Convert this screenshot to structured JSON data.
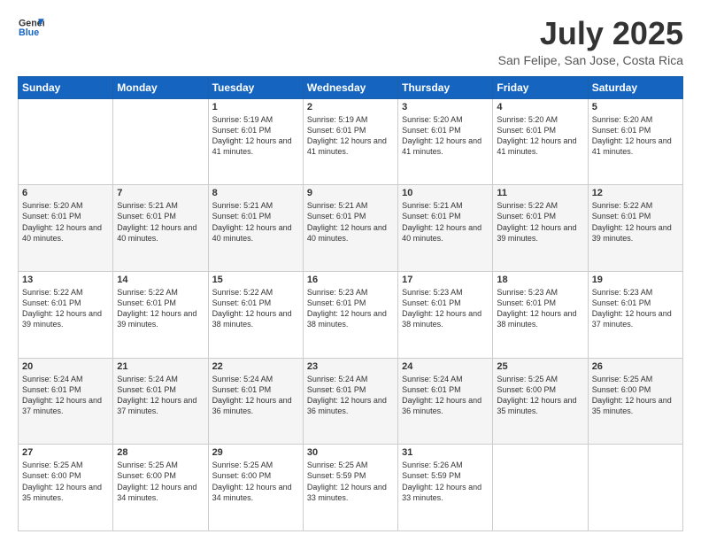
{
  "header": {
    "logo_line1": "General",
    "logo_line2": "Blue",
    "month": "July 2025",
    "location": "San Felipe, San Jose, Costa Rica"
  },
  "weekdays": [
    "Sunday",
    "Monday",
    "Tuesday",
    "Wednesday",
    "Thursday",
    "Friday",
    "Saturday"
  ],
  "weeks": [
    [
      {
        "day": "",
        "text": ""
      },
      {
        "day": "",
        "text": ""
      },
      {
        "day": "1",
        "text": "Sunrise: 5:19 AM\nSunset: 6:01 PM\nDaylight: 12 hours and 41 minutes."
      },
      {
        "day": "2",
        "text": "Sunrise: 5:19 AM\nSunset: 6:01 PM\nDaylight: 12 hours and 41 minutes."
      },
      {
        "day": "3",
        "text": "Sunrise: 5:20 AM\nSunset: 6:01 PM\nDaylight: 12 hours and 41 minutes."
      },
      {
        "day": "4",
        "text": "Sunrise: 5:20 AM\nSunset: 6:01 PM\nDaylight: 12 hours and 41 minutes."
      },
      {
        "day": "5",
        "text": "Sunrise: 5:20 AM\nSunset: 6:01 PM\nDaylight: 12 hours and 41 minutes."
      }
    ],
    [
      {
        "day": "6",
        "text": "Sunrise: 5:20 AM\nSunset: 6:01 PM\nDaylight: 12 hours and 40 minutes."
      },
      {
        "day": "7",
        "text": "Sunrise: 5:21 AM\nSunset: 6:01 PM\nDaylight: 12 hours and 40 minutes."
      },
      {
        "day": "8",
        "text": "Sunrise: 5:21 AM\nSunset: 6:01 PM\nDaylight: 12 hours and 40 minutes."
      },
      {
        "day": "9",
        "text": "Sunrise: 5:21 AM\nSunset: 6:01 PM\nDaylight: 12 hours and 40 minutes."
      },
      {
        "day": "10",
        "text": "Sunrise: 5:21 AM\nSunset: 6:01 PM\nDaylight: 12 hours and 40 minutes."
      },
      {
        "day": "11",
        "text": "Sunrise: 5:22 AM\nSunset: 6:01 PM\nDaylight: 12 hours and 39 minutes."
      },
      {
        "day": "12",
        "text": "Sunrise: 5:22 AM\nSunset: 6:01 PM\nDaylight: 12 hours and 39 minutes."
      }
    ],
    [
      {
        "day": "13",
        "text": "Sunrise: 5:22 AM\nSunset: 6:01 PM\nDaylight: 12 hours and 39 minutes."
      },
      {
        "day": "14",
        "text": "Sunrise: 5:22 AM\nSunset: 6:01 PM\nDaylight: 12 hours and 39 minutes."
      },
      {
        "day": "15",
        "text": "Sunrise: 5:22 AM\nSunset: 6:01 PM\nDaylight: 12 hours and 38 minutes."
      },
      {
        "day": "16",
        "text": "Sunrise: 5:23 AM\nSunset: 6:01 PM\nDaylight: 12 hours and 38 minutes."
      },
      {
        "day": "17",
        "text": "Sunrise: 5:23 AM\nSunset: 6:01 PM\nDaylight: 12 hours and 38 minutes."
      },
      {
        "day": "18",
        "text": "Sunrise: 5:23 AM\nSunset: 6:01 PM\nDaylight: 12 hours and 38 minutes."
      },
      {
        "day": "19",
        "text": "Sunrise: 5:23 AM\nSunset: 6:01 PM\nDaylight: 12 hours and 37 minutes."
      }
    ],
    [
      {
        "day": "20",
        "text": "Sunrise: 5:24 AM\nSunset: 6:01 PM\nDaylight: 12 hours and 37 minutes."
      },
      {
        "day": "21",
        "text": "Sunrise: 5:24 AM\nSunset: 6:01 PM\nDaylight: 12 hours and 37 minutes."
      },
      {
        "day": "22",
        "text": "Sunrise: 5:24 AM\nSunset: 6:01 PM\nDaylight: 12 hours and 36 minutes."
      },
      {
        "day": "23",
        "text": "Sunrise: 5:24 AM\nSunset: 6:01 PM\nDaylight: 12 hours and 36 minutes."
      },
      {
        "day": "24",
        "text": "Sunrise: 5:24 AM\nSunset: 6:01 PM\nDaylight: 12 hours and 36 minutes."
      },
      {
        "day": "25",
        "text": "Sunrise: 5:25 AM\nSunset: 6:00 PM\nDaylight: 12 hours and 35 minutes."
      },
      {
        "day": "26",
        "text": "Sunrise: 5:25 AM\nSunset: 6:00 PM\nDaylight: 12 hours and 35 minutes."
      }
    ],
    [
      {
        "day": "27",
        "text": "Sunrise: 5:25 AM\nSunset: 6:00 PM\nDaylight: 12 hours and 35 minutes."
      },
      {
        "day": "28",
        "text": "Sunrise: 5:25 AM\nSunset: 6:00 PM\nDaylight: 12 hours and 34 minutes."
      },
      {
        "day": "29",
        "text": "Sunrise: 5:25 AM\nSunset: 6:00 PM\nDaylight: 12 hours and 34 minutes."
      },
      {
        "day": "30",
        "text": "Sunrise: 5:25 AM\nSunset: 5:59 PM\nDaylight: 12 hours and 33 minutes."
      },
      {
        "day": "31",
        "text": "Sunrise: 5:26 AM\nSunset: 5:59 PM\nDaylight: 12 hours and 33 minutes."
      },
      {
        "day": "",
        "text": ""
      },
      {
        "day": "",
        "text": ""
      }
    ]
  ]
}
